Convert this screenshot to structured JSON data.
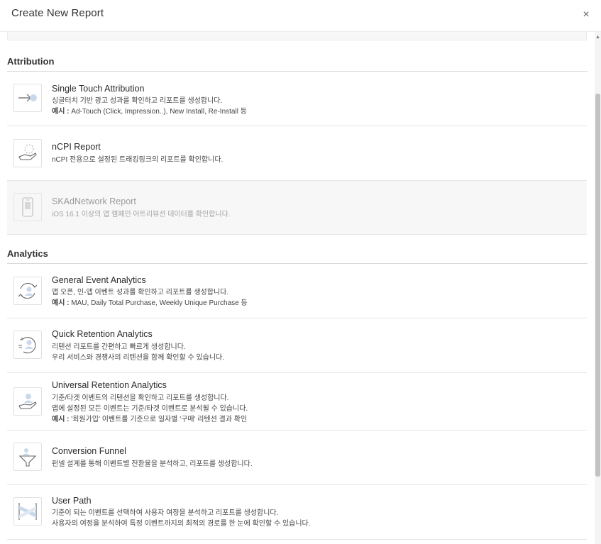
{
  "header": {
    "title": "Create New Report",
    "close_symbol": "×"
  },
  "sections": {
    "attribution": {
      "title": "Attribution"
    },
    "analytics": {
      "title": "Analytics"
    }
  },
  "items": {
    "single_touch": {
      "name": "Single Touch Attribution",
      "line1": "싱글터치 기반 광고 성과를 확인하고 리포트를 생성합니다.",
      "example_label": "예시 : ",
      "example_text": "Ad-Touch (Click, Impression..), New Install, Re-Install 등",
      "icon": "arrow-to-dot-icon"
    },
    "ncpi": {
      "name": "nCPI Report",
      "line1": "nCPI 전용으로 설정된 트래킹링크의 리포트를 확인합니다.",
      "icon": "hand-coin-icon"
    },
    "skadnetwork": {
      "name": "SKAdNetwork Report",
      "line1": "iOS 16.1 이상의 앱 캠페인 어트리뷰션 데이터를 확인합니다.",
      "icon": "phone-icon",
      "disabled": true
    },
    "general_event": {
      "name": "General Event Analytics",
      "line1": "앱 오픈, 인-앱 이벤트 성과를 확인하고 리포트를 생성합니다.",
      "example_label": "예시 : ",
      "example_text": "MAU, Daily Total Purchase, Weekly Unique Purchase 등",
      "icon": "user-cycle-icon"
    },
    "quick_retention": {
      "name": "Quick Retention Analytics",
      "line1": "리텐션 리포트를 간편하고 빠르게 생성합니다.",
      "line2": "우리 서비스와 경쟁사의 리텐션을 함께 확인할 수 있습니다.",
      "icon": "user-refresh-icon"
    },
    "universal_retention": {
      "name": "Universal Retention Analytics",
      "line1": "기준/타겟 이벤트의 리텐션을 확인하고 리포트를 생성합니다.",
      "line2": "앱에 설정된 모든 이벤트는 기준/타겟 이벤트로 분석될 수 있습니다.",
      "example_label": "예시 : ",
      "example_text": "'회원가입' 이벤트를 기준으로 일자별 '구매' 리텐션 결과 확인",
      "icon": "user-hand-icon"
    },
    "conversion_funnel": {
      "name": "Conversion Funnel",
      "line1": "펀넬 설계를 통해 이벤트별 전환율을 분석하고, 리포트를 생성합니다.",
      "icon": "funnel-icon"
    },
    "user_path": {
      "name": "User Path",
      "line1": "기준이 되는 이벤트를 선택하여 사용자 여정을 분석하고 리포트를 생성합니다.",
      "line2": "사용자의 여정을 분석하여 특정 이벤트까지의 최적의 경로를 한 눈에 확인할 수 있습니다.",
      "icon": "path-flow-icon"
    }
  },
  "colors": {
    "accent": "#7aa7d6",
    "disabled_bg": "#f7f7f7",
    "divider": "#e6e6e6"
  },
  "scrollbar": {
    "up_symbol": "▲"
  }
}
